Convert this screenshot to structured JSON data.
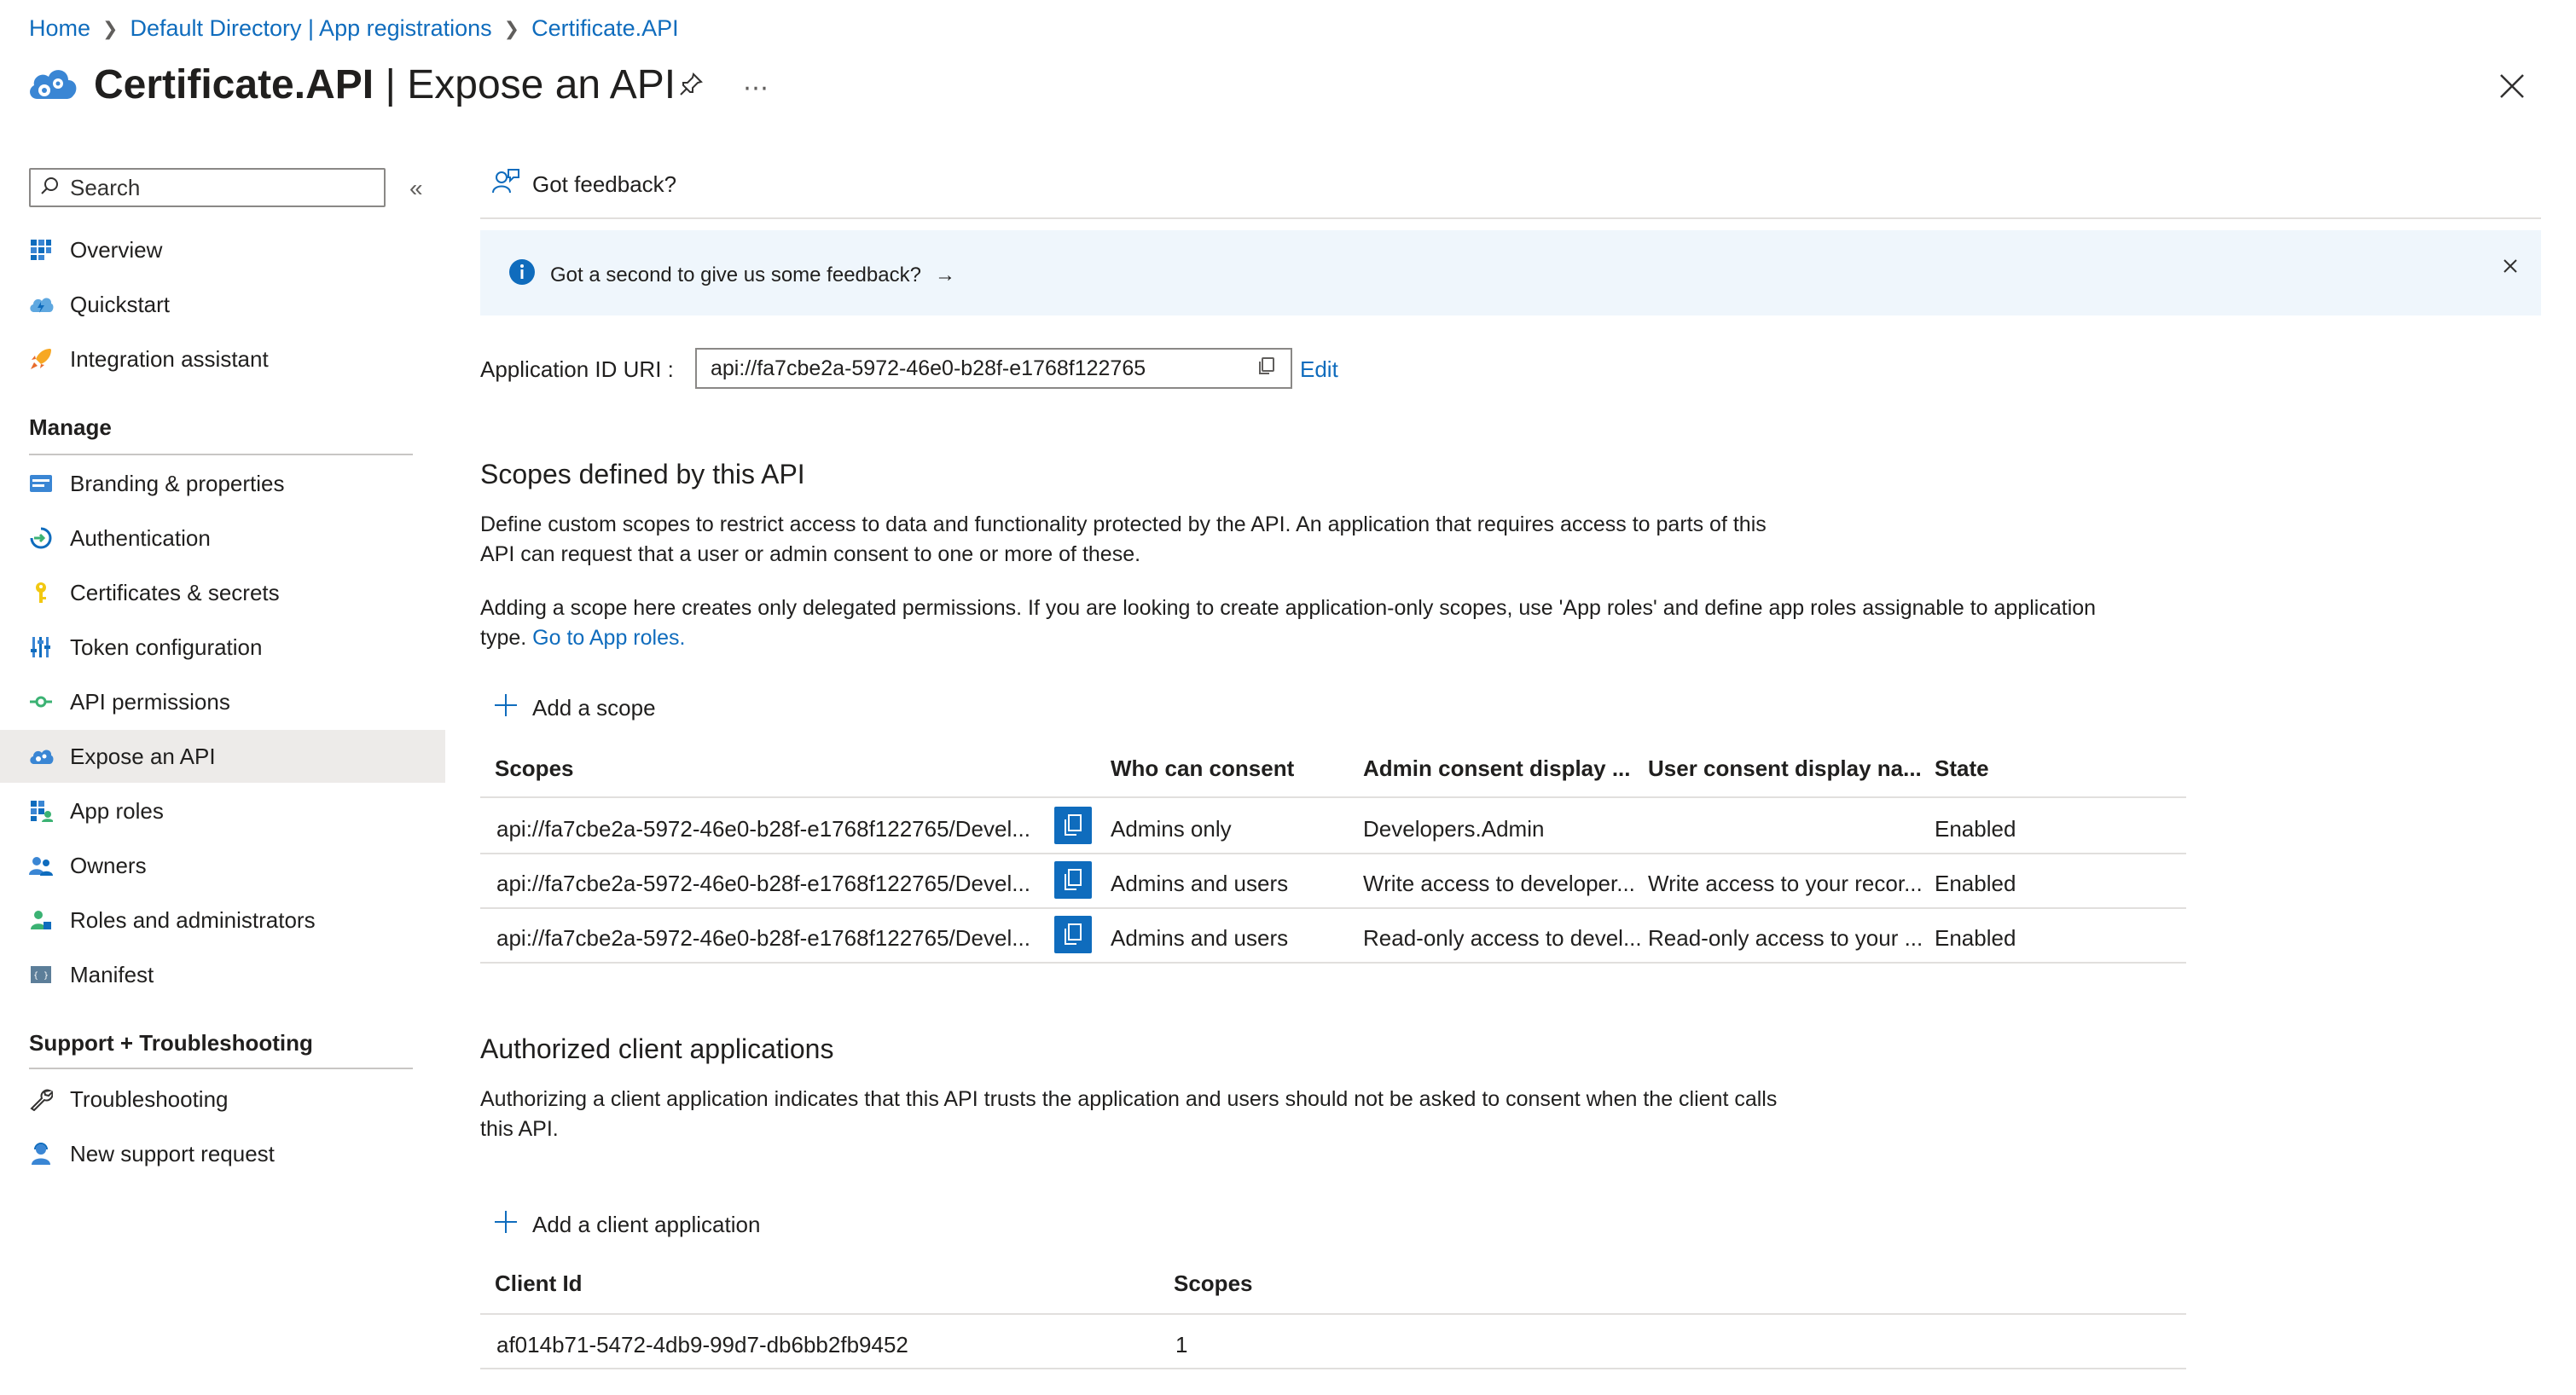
{
  "breadcrumb": {
    "home": "Home",
    "directory": "Default Directory | App registrations",
    "app": "Certificate.API"
  },
  "header": {
    "title_main": "Certificate.API",
    "title_rest": " | Expose an API"
  },
  "sidebar": {
    "search_placeholder": "Search",
    "items_top": [
      {
        "label": "Overview"
      },
      {
        "label": "Quickstart"
      },
      {
        "label": "Integration assistant"
      }
    ],
    "manage_label": "Manage",
    "items_manage": [
      {
        "label": "Branding & properties"
      },
      {
        "label": "Authentication"
      },
      {
        "label": "Certificates & secrets"
      },
      {
        "label": "Token configuration"
      },
      {
        "label": "API permissions"
      },
      {
        "label": "Expose an API"
      },
      {
        "label": "App roles"
      },
      {
        "label": "Owners"
      },
      {
        "label": "Roles and administrators"
      },
      {
        "label": "Manifest"
      }
    ],
    "support_label": "Support + Troubleshooting",
    "items_support": [
      {
        "label": "Troubleshooting"
      },
      {
        "label": "New support request"
      }
    ]
  },
  "toolbar": {
    "feedback_label": "Got feedback?"
  },
  "banner": {
    "text": "Got a second to give us some feedback?",
    "arrow": "→"
  },
  "app_id_uri": {
    "label": "Application ID URI :",
    "value": "api://fa7cbe2a-5972-46e0-b28f-e1768f122765",
    "edit_label": "Edit"
  },
  "scopes": {
    "heading": "Scopes defined by this API",
    "desc1": "Define custom scopes to restrict access to data and functionality protected by the API. An application that requires access to parts of this",
    "desc1b": "API can request that a user or admin consent to one or more of these.",
    "desc2": "Adding a scope here creates only delegated permissions. If you are looking to create application-only scopes, use 'App roles' and define app roles assignable to application",
    "desc2b_prefix": "type.",
    "desc2b_link": "Go to App roles.",
    "add_label": "Add a scope",
    "columns": [
      "Scopes",
      "Who can consent",
      "Admin consent display ...",
      "User consent display na...",
      "State"
    ],
    "rows": [
      {
        "scope": "api://fa7cbe2a-5972-46e0-b28f-e1768f122765/Devel...",
        "who": "Admins only",
        "admin": "Developers.Admin",
        "user": "",
        "state": "Enabled"
      },
      {
        "scope": "api://fa7cbe2a-5972-46e0-b28f-e1768f122765/Devel...",
        "who": "Admins and users",
        "admin": "Write access to developer...",
        "user": "Write access to your recor...",
        "state": "Enabled"
      },
      {
        "scope": "api://fa7cbe2a-5972-46e0-b28f-e1768f122765/Devel...",
        "who": "Admins and users",
        "admin": "Read-only access to devel...",
        "user": "Read-only access to your ...",
        "state": "Enabled"
      }
    ]
  },
  "clients": {
    "heading": "Authorized client applications",
    "desc": "Authorizing a client application indicates that this API trusts the application and users should not be asked to consent when the client calls",
    "descb": "this API.",
    "add_label": "Add a client application",
    "columns": [
      "Client Id",
      "Scopes"
    ],
    "rows": [
      {
        "client_id": "af014b71-5472-4db9-99d7-db6bb2fb9452",
        "scopes": "1"
      }
    ]
  },
  "colors": {
    "accent": "#0f6cbd",
    "selected_nav": "#edebe9",
    "banner_bg": "#eff6fc"
  }
}
